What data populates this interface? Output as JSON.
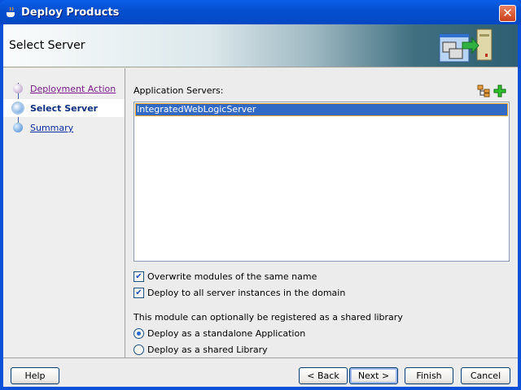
{
  "window": {
    "title": "Deploy Products",
    "close_icon": "close-icon",
    "app_icon": "java-cup-icon"
  },
  "header": {
    "title": "Select Server",
    "icon": "deploy-to-server-icon"
  },
  "steps": [
    {
      "label": "Deployment Action",
      "state": "visited"
    },
    {
      "label": "Select Server",
      "state": "current"
    },
    {
      "label": "Summary",
      "state": "pending"
    }
  ],
  "main": {
    "servers_label": "Application Servers:",
    "servers": [
      "IntegratedWebLogicServer"
    ],
    "selected_server": "IntegratedWebLogicServer",
    "toolbar": {
      "browse_icon": "server-tree-icon",
      "add_icon": "add-plus-icon"
    },
    "checkboxes": [
      {
        "label": "Overwrite modules of the same name",
        "checked": true
      },
      {
        "label": "Deploy to all server instances in the domain",
        "checked": true
      }
    ],
    "shared_note": "This module can optionally be registered as a shared library",
    "radios": [
      {
        "label": "Deploy as a standalone Application",
        "selected": true
      },
      {
        "label": "Deploy as a shared Library",
        "selected": false
      }
    ]
  },
  "footer": {
    "help": "Help",
    "back": "< Back",
    "next": "Next >",
    "finish": "Finish",
    "cancel": "Cancel"
  },
  "colors": {
    "titlebar": "#0550d0",
    "selection": "#316ac5",
    "visited_link": "#7a1a8a",
    "link": "#0c2e9e"
  }
}
